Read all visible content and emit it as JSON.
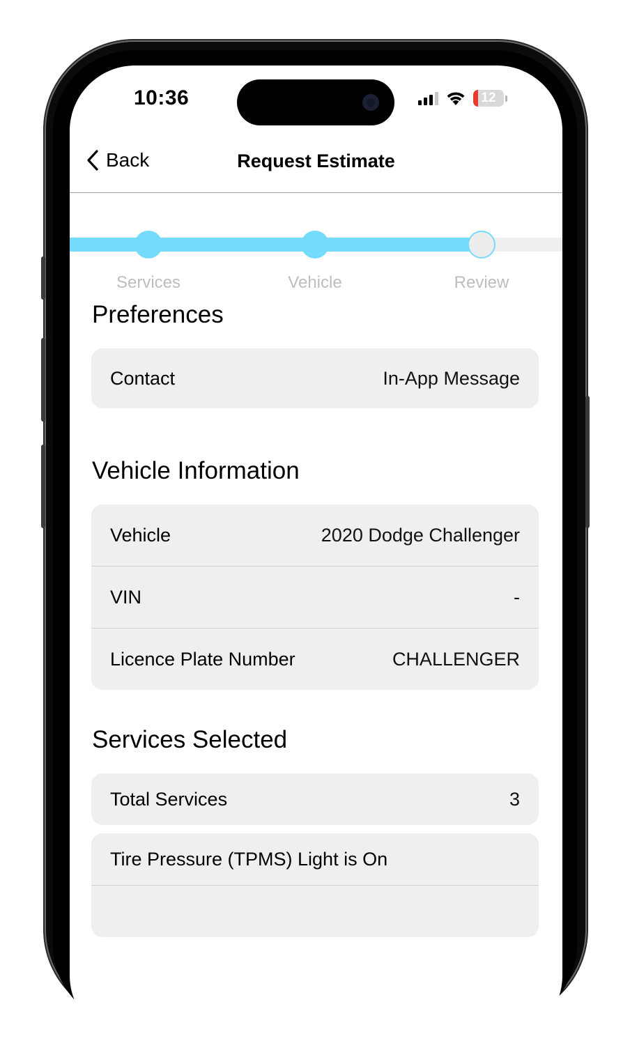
{
  "status_bar": {
    "time": "10:36",
    "battery_level": "12",
    "battery_color": "#eb3b30",
    "icons": [
      "signal-icon",
      "wifi-icon",
      "battery-icon"
    ]
  },
  "nav": {
    "back_label": "Back",
    "title": "Request Estimate"
  },
  "progress": {
    "accent": "#74dbfd",
    "steps": [
      "Services",
      "Vehicle",
      "Review"
    ],
    "current_step": 3
  },
  "preferences": {
    "heading": "Preferences",
    "rows": [
      {
        "label": "Contact",
        "value": "In-App Message"
      }
    ]
  },
  "vehicle_info": {
    "heading": "Vehicle Information",
    "rows": [
      {
        "label": "Vehicle",
        "value": "2020 Dodge Challenger"
      },
      {
        "label": "VIN",
        "value": "-"
      },
      {
        "label": "Licence Plate Number",
        "value": "CHALLENGER"
      }
    ]
  },
  "services": {
    "heading": "Services Selected",
    "total_label": "Total Services",
    "total_value": "3",
    "items": [
      "Tire Pressure (TPMS) Light is On"
    ]
  }
}
